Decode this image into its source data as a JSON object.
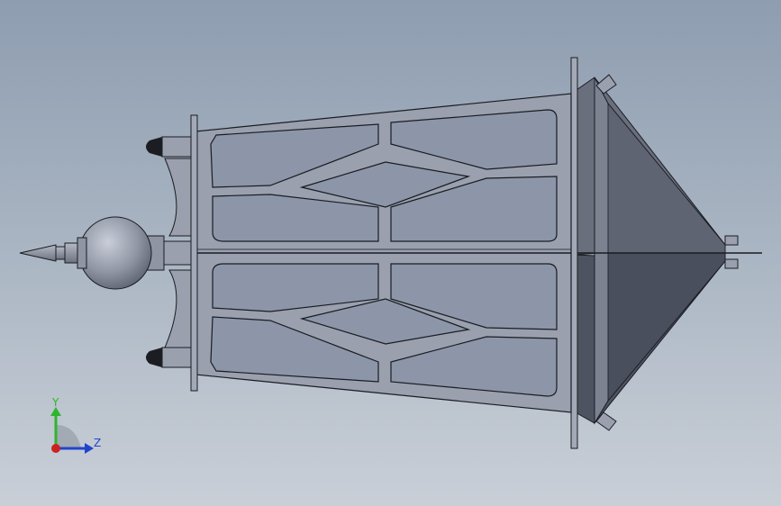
{
  "viewport": {
    "background_top": "#8e9db0",
    "background_bottom": "#c9cfd7",
    "model_fill": "#9aa0ae",
    "model_dark": "#5c6170",
    "model_edge": "#1a1c22"
  },
  "triad": {
    "y_label": "Y",
    "z_label": "Z",
    "y_color": "#2db52d",
    "z_color": "#2244cc",
    "x_color": "#cc2222"
  }
}
